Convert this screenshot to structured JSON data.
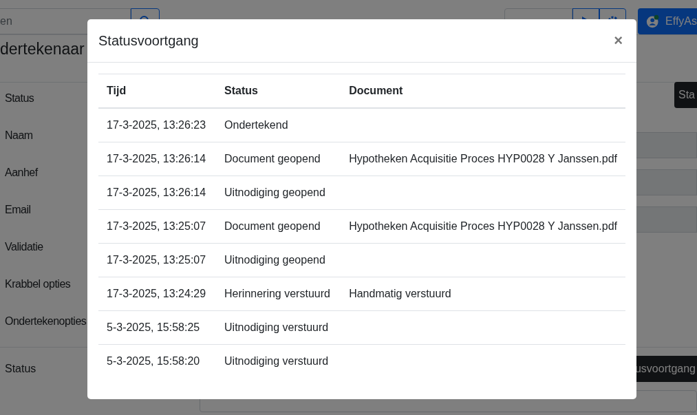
{
  "page": {
    "search": {
      "placeholder": "en"
    },
    "heading": "dertekenaar",
    "user_button": "EffyAs",
    "status_button": "Sta",
    "fields": [
      {
        "label": "Status",
        "kind": "button"
      },
      {
        "label": "Naam",
        "kind": "input"
      },
      {
        "label": "Aanhef",
        "kind": "input"
      },
      {
        "label": "Email",
        "kind": "input"
      },
      {
        "label": "Validatie",
        "kind": "plain"
      },
      {
        "label": "Krabbel opties",
        "kind": "plain"
      },
      {
        "label": "Ondertekenopties",
        "kind": "plain"
      }
    ],
    "bottom": {
      "label": "Status",
      "button": "usvoortgang"
    }
  },
  "modal": {
    "title": "Statusvoortgang",
    "close": "×",
    "columns": [
      "Tijd",
      "Status",
      "Document"
    ],
    "rows": [
      [
        "17-3-2025, 13:26:23",
        "Ondertekend",
        ""
      ],
      [
        "17-3-2025, 13:26:14",
        "Document geopend",
        "Hypotheken Acquisitie Proces HYP0028 Y Janssen.pdf"
      ],
      [
        "17-3-2025, 13:26:14",
        "Uitnodiging geopend",
        ""
      ],
      [
        "17-3-2025, 13:25:07",
        "Document geopend",
        "Hypotheken Acquisitie Proces HYP0028 Y Janssen.pdf"
      ],
      [
        "17-3-2025, 13:25:07",
        "Uitnodiging geopend",
        ""
      ],
      [
        "17-3-2025, 13:24:29",
        "Herinnering verstuurd",
        "Handmatig verstuurd"
      ],
      [
        "5-3-2025, 15:58:25",
        "Uitnodiging verstuurd",
        ""
      ],
      [
        "5-3-2025, 15:58:20",
        "Uitnodiging verstuurd",
        ""
      ]
    ]
  }
}
